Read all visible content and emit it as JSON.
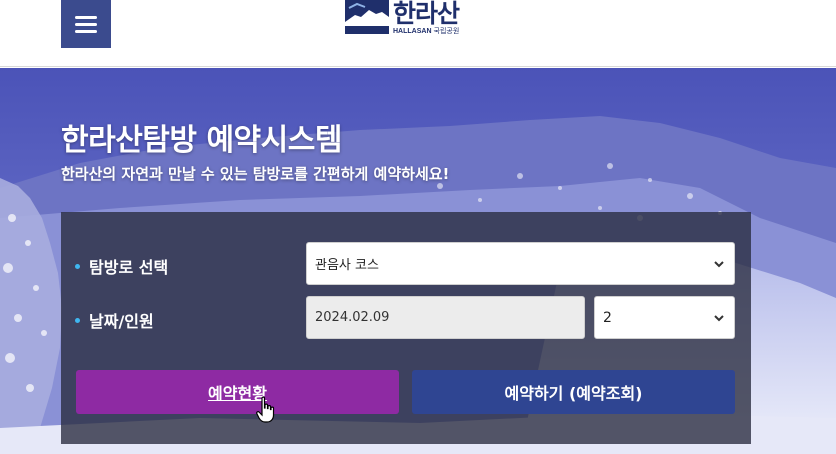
{
  "header": {
    "menu_icon": "hamburger-menu-icon",
    "logo": {
      "korean": "한라산",
      "english": "HALLASAN",
      "english_sub": "국립공원"
    }
  },
  "hero": {
    "title": "한라산탐방 예약시스템",
    "subtitle": "한라산의 자연과 만날 수 있는 탐방로를 간편하게 예약하세요!"
  },
  "form": {
    "trail_label": "탐방로 선택",
    "trail_value": "관음사 코스",
    "date_label": "날짜/인원",
    "date_value": "2024.02.09",
    "people_value": "2"
  },
  "buttons": {
    "status_label": "예약현황",
    "reserve_label": "예약하기 (예약조회)"
  },
  "colors": {
    "header_menu": "#3b4b8e",
    "status_button": "#8e2aa3",
    "reserve_button": "#2f4592",
    "bullet": "#3fb6f0"
  }
}
